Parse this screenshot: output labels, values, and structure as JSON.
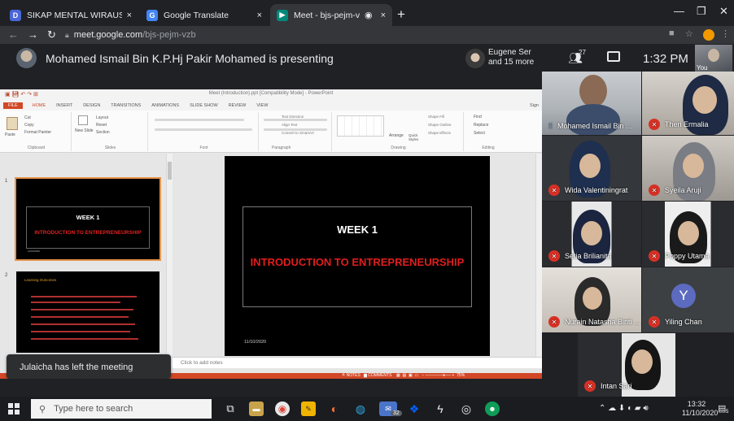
{
  "browser": {
    "tabs": [
      {
        "label": "SIKAP MENTAL WIRAUSAHA - P",
        "favicon": "document-favicon",
        "color": "#4a66d8"
      },
      {
        "label": "Google Translate",
        "favicon": "translate-favicon",
        "color": "#4285f4"
      },
      {
        "label": "Meet - bjs-pejm-vzb",
        "favicon": "meet-favicon",
        "color": "#00897b",
        "active": true
      }
    ],
    "close_glyph": "×",
    "new_tab_glyph": "+",
    "url_host": "meet.google.com",
    "url_path": "/bjs-pejm-vzb"
  },
  "meet": {
    "presenting_text": "Mohamed Ismail Bin K.P.Hj Pakir Mohamed is presenting",
    "other_presenters": "Eugene Ser and 15 more",
    "people_count": "27",
    "time": "1:32 PM",
    "self_label": "You",
    "toast": "Julaicha has left the meeting",
    "accent": "#1a73e8",
    "muted_color": "#d93025"
  },
  "ppt": {
    "window_title": "Meet (Introduction).ppt [Compatibility Mode] - PowerPoint",
    "ribbon_tabs": [
      "FILE",
      "HOME",
      "INSERT",
      "DESIGN",
      "TRANSITIONS",
      "ANIMATIONS",
      "SLIDE SHOW",
      "REVIEW",
      "VIEW"
    ],
    "sign_in": "Sign",
    "ribbon_groups": [
      "Clipboard",
      "Slides",
      "Font",
      "Paragraph",
      "Drawing",
      "Editing"
    ],
    "ribbon_buttons": {
      "paste": "Paste",
      "cut": "Cut",
      "copy": "Copy",
      "format_painter": "Format Painter",
      "new_slide": "New Slide",
      "layout": "Layout",
      "reset": "Reset",
      "section": "Section",
      "text_direction": "Text Direction",
      "align_text": "Align Text",
      "convert_smartart": "Convert to SmartArt",
      "arrange": "Arrange",
      "quick_styles": "Quick Styles",
      "shape_fill": "Shape Fill",
      "shape_outline": "Shape Outline",
      "shape_effects": "Shape Effects",
      "find": "Find",
      "replace": "Replace",
      "select": "Select"
    },
    "slide1_num": "1",
    "slide2_num": "2",
    "slide_title": "WEEK 1",
    "slide_subtitle": "INTRODUCTION TO ENTREPRENEURSHIP",
    "slide_date": "11/10/2020",
    "slide2_heading": "Learning Outcomes",
    "notes_placeholder": "Click to add notes",
    "status_notes": "NOTES",
    "status_comments": "COMMENTS",
    "zoom": "75%"
  },
  "participants": [
    {
      "name": "Mohamed Ismail Bin ...",
      "muted": false
    },
    {
      "name": "Theri Ermalia",
      "muted": true
    },
    {
      "name": "Wida Valentiningrat",
      "muted": true
    },
    {
      "name": "Syeila Aruji",
      "muted": true
    },
    {
      "name": "Setia Brilianita",
      "muted": true
    },
    {
      "name": "Poppy Utama",
      "muted": true
    },
    {
      "name": "Nurain Natasha Binti ...",
      "muted": true
    },
    {
      "name": "Yiling Chan",
      "muted": true,
      "initial": "Y"
    },
    {
      "name": "Intan Sari",
      "muted": true
    }
  ],
  "taskbar": {
    "search_placeholder": "Type here to search",
    "badge_count": "32",
    "time": "13:32",
    "date": "11/10/2020",
    "notif_count": "5"
  }
}
